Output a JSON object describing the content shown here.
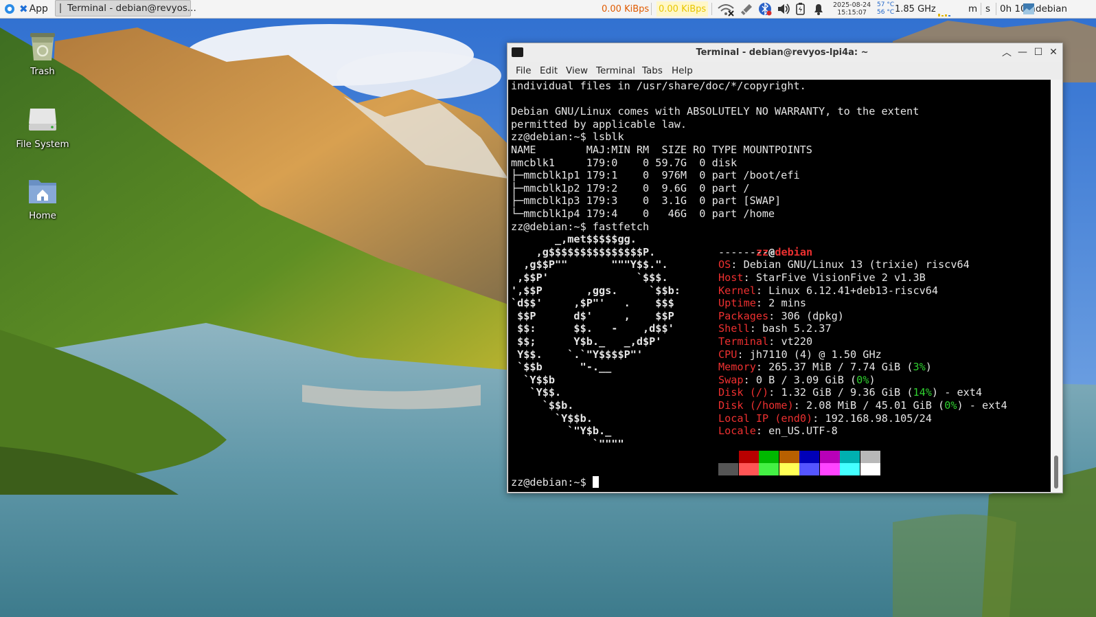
{
  "panel": {
    "apps_label": "App",
    "task_title": "Terminal - debian@revyos...",
    "net_down": "0.00 KiBps",
    "net_up": "0.00 KiBps",
    "date": "2025-08-24",
    "time": "15:15:07",
    "temp1": "57 °C",
    "temp2": "56 °C",
    "cpu_freq": "1.85 GHz",
    "mem_label": "m",
    "swap_label": "s",
    "uptime": "0h 10m",
    "user": "debian",
    "icons": [
      "whisker-menu-icon",
      "wifi-icon",
      "network-icon",
      "bluetooth-icon",
      "volume-icon",
      "battery-icon",
      "notification-bell-icon",
      "cpu-graph-icon"
    ]
  },
  "desktop": {
    "icons": [
      {
        "label": "Trash",
        "icon": "trash-icon"
      },
      {
        "label": "File System",
        "icon": "drive-icon"
      },
      {
        "label": "Home",
        "icon": "home-folder-icon"
      }
    ]
  },
  "window": {
    "title": "Terminal - debian@revyos-lpi4a: ~",
    "menu": [
      "File",
      "Edit",
      "View",
      "Terminal",
      "Tabs",
      "Help"
    ]
  },
  "terminal": {
    "motd": [
      "individual files in /usr/share/doc/*/copyright.",
      "",
      "Debian GNU/Linux comes with ABSOLUTELY NO WARRANTY, to the extent",
      "permitted by applicable law."
    ],
    "cmd1": "zz@debian:~$ lsblk",
    "lsblk": [
      "NAME        MAJ:MIN RM  SIZE RO TYPE MOUNTPOINTS",
      "mmcblk1     179:0    0 59.7G  0 disk",
      "├─mmcblk1p1 179:1    0  976M  0 part /boot/efi",
      "├─mmcblk1p2 179:2    0  9.6G  0 part /",
      "├─mmcblk1p3 179:3    0  3.1G  0 part [SWAP]",
      "└─mmcblk1p4 179:4    0   46G  0 part /home"
    ],
    "cmd2": "zz@debian:~$ fastfetch",
    "logo": [
      "       _,met$$$$$gg.",
      "    ,g$$$$$$$$$$$$$$$P.",
      "  ,g$$P\"\"       \"\"\"Y$$.\".",
      " ,$$P'              `$$$.",
      "',$$P       ,ggs.     `$$b:",
      "`d$$'     ,$P\"'   .    $$$",
      " $$P      d$'     ,    $$P",
      " $$:      $$.   -    ,d$$'",
      " $$;      Y$b._   _,d$P'",
      " Y$$.    `.`\"Y$$$$P\"'",
      " `$$b      \"-.__",
      "  `Y$$b",
      "   `Y$$.",
      "     `$$b.",
      "       `Y$$b.",
      "         `\"Y$b._",
      "             `\"\"\"\""
    ],
    "info_user": "zz",
    "info_at": "@",
    "info_host": "debian",
    "info_sep": "---------",
    "info": [
      {
        "key": "OS",
        "value": ": Debian GNU/Linux 13 (trixie) riscv64"
      },
      {
        "key": "Host",
        "value": ": StarFive VisionFive 2 v1.3B"
      },
      {
        "key": "Kernel",
        "value": ": Linux 6.12.41+deb13-riscv64"
      },
      {
        "key": "Uptime",
        "value": ": 2 mins"
      },
      {
        "key": "Packages",
        "value": ": 306 (dpkg)"
      },
      {
        "key": "Shell",
        "value": ": bash 5.2.37"
      },
      {
        "key": "Terminal",
        "value": ": vt220"
      },
      {
        "key": "CPU",
        "value": ": jh7110 (4) @ 1.50 GHz"
      }
    ],
    "memory": {
      "key": "Memory",
      "pre": ": 265.37 MiB / 7.74 GiB (",
      "pct": "3%",
      "post": ")"
    },
    "swap": {
      "key": "Swap",
      "pre": ": 0 B / 3.09 GiB (",
      "pct": "0%",
      "post": ")"
    },
    "disk_root": {
      "key": "Disk (/)",
      "pre": ": 1.32 GiB / 9.36 GiB (",
      "pct": "14%",
      "post": ") - ext4"
    },
    "disk_home": {
      "key": "Disk (/home)",
      "pre": ": 2.08 MiB / 45.01 GiB (",
      "pct": "0%",
      "post": ") - ext4"
    },
    "local_ip": {
      "key": "Local IP (end0)",
      "value": ": 192.168.98.105/24"
    },
    "locale": {
      "key": "Locale",
      "value": ": en_US.UTF-8"
    },
    "palette_top": [
      "#000000",
      "#b80000",
      "#00b800",
      "#b86000",
      "#0000b8",
      "#b800b8",
      "#00b0b0",
      "#b8b8b8"
    ],
    "palette_bottom": [
      "#555555",
      "#ff5555",
      "#44f044",
      "#ffff55",
      "#5555ff",
      "#ff44ff",
      "#44ffff",
      "#ffffff"
    ],
    "prompt": "zz@debian:~$ "
  }
}
